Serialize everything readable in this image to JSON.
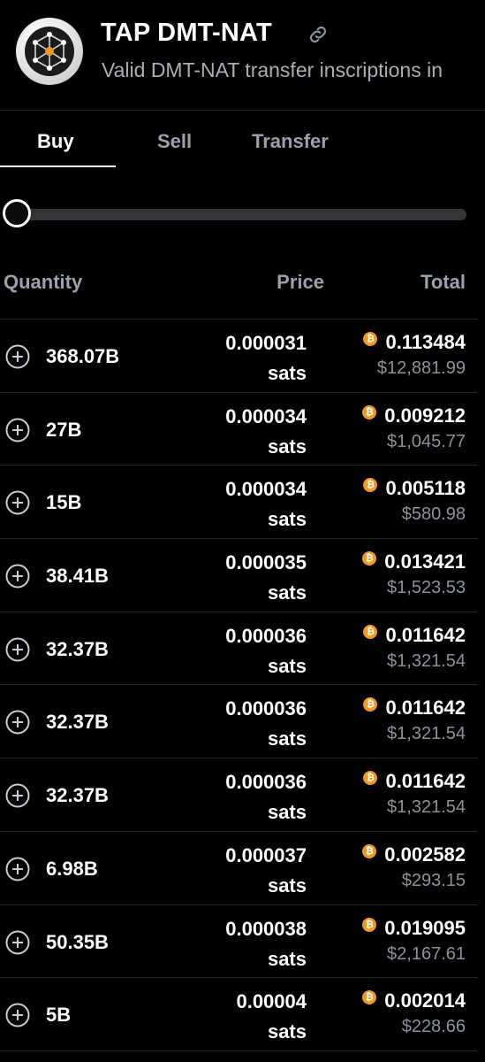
{
  "header": {
    "title": "TAP DMT-NAT",
    "subtitle": "Valid DMT-NAT transfer inscriptions in",
    "logo_icon": "nat-node-logo-icon",
    "link_icon": "link-icon"
  },
  "tabs": [
    {
      "label": "Buy",
      "active": true
    },
    {
      "label": "Sell",
      "active": false
    },
    {
      "label": "Transfer",
      "active": false
    }
  ],
  "slider": {
    "value": 0
  },
  "columns": {
    "quantity": "Quantity",
    "price": "Price",
    "total": "Total"
  },
  "colors": {
    "background": "#000000",
    "btc_orange": "#f39a1c",
    "muted": "#9aa1ab"
  },
  "rows": [
    {
      "quantity": "368.07B",
      "price": "0.000031",
      "unit": "sats",
      "btc": "0.113484",
      "usd": "$12,881.99"
    },
    {
      "quantity": "27B",
      "price": "0.000034",
      "unit": "sats",
      "btc": "0.009212",
      "usd": "$1,045.77"
    },
    {
      "quantity": "15B",
      "price": "0.000034",
      "unit": "sats",
      "btc": "0.005118",
      "usd": "$580.98"
    },
    {
      "quantity": "38.41B",
      "price": "0.000035",
      "unit": "sats",
      "btc": "0.013421",
      "usd": "$1,523.53"
    },
    {
      "quantity": "32.37B",
      "price": "0.000036",
      "unit": "sats",
      "btc": "0.011642",
      "usd": "$1,321.54"
    },
    {
      "quantity": "32.37B",
      "price": "0.000036",
      "unit": "sats",
      "btc": "0.011642",
      "usd": "$1,321.54"
    },
    {
      "quantity": "32.37B",
      "price": "0.000036",
      "unit": "sats",
      "btc": "0.011642",
      "usd": "$1,321.54"
    },
    {
      "quantity": "6.98B",
      "price": "0.000037",
      "unit": "sats",
      "btc": "0.002582",
      "usd": "$293.15"
    },
    {
      "quantity": "50.35B",
      "price": "0.000038",
      "unit": "sats",
      "btc": "0.019095",
      "usd": "$2,167.61"
    },
    {
      "quantity": "5B",
      "price": "0.00004",
      "unit": "sats",
      "btc": "0.002014",
      "usd": "$228.66"
    }
  ]
}
